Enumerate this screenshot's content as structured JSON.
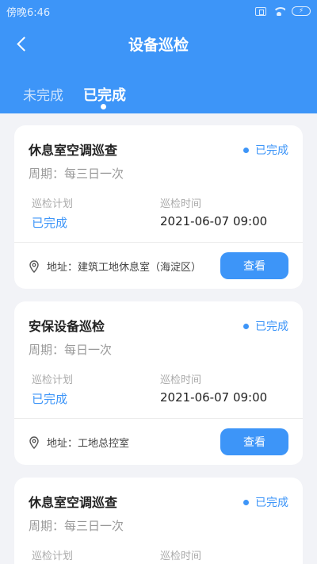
{
  "status_bar": {
    "time": "傍晚6:46",
    "battery_symbol": "⚡"
  },
  "header": {
    "title": "设备巡检"
  },
  "tabs": [
    {
      "label": "未完成",
      "active": false
    },
    {
      "label": "已完成",
      "active": true
    }
  ],
  "cards": [
    {
      "title": "休息室空调巡查",
      "status": "已完成",
      "period": "周期：每三日一次",
      "plan_label": "巡检计划",
      "plan_value": "已完成",
      "time_label": "巡检时间",
      "time_value": "2021-06-07 09:00",
      "address": "地址：建筑工地休息室（海淀区）",
      "button": "查看"
    },
    {
      "title": "安保设备巡检",
      "status": "已完成",
      "period": "周期：每日一次",
      "plan_label": "巡检计划",
      "plan_value": "已完成",
      "time_label": "巡检时间",
      "time_value": "2021-06-07 09:00",
      "address": "地址：工地总控室",
      "button": "查看"
    },
    {
      "title": "休息室空调巡查",
      "status": "已完成",
      "period": "周期：每三日一次",
      "plan_label": "巡检计划",
      "plan_value": "",
      "time_label": "巡检时间",
      "time_value": "",
      "address": "",
      "button": ""
    }
  ],
  "colors": {
    "primary": "#3d95f8",
    "background": "#f2f3f7",
    "card": "#ffffff"
  },
  "icons": {
    "back": "chevron-left-icon",
    "address": "location-pin-icon",
    "status": "status-dot-icon"
  }
}
